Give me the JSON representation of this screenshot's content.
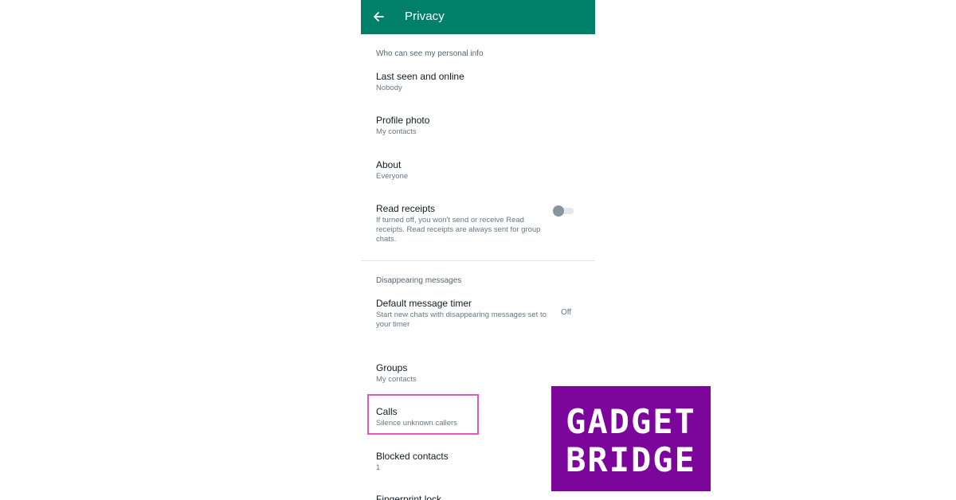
{
  "colors": {
    "appbar": "#008069",
    "highlight_box": "#e754c5",
    "logo_background": "#7c069c"
  },
  "appbar": {
    "back_icon": "arrow-left-icon",
    "title": "Privacy"
  },
  "personal_info": {
    "header": "Who can see my personal info",
    "items": [
      {
        "title": "Last seen and online",
        "subtitle": "Nobody"
      },
      {
        "title": "Profile photo",
        "subtitle": "My contacts"
      },
      {
        "title": "About",
        "subtitle": "Everyone"
      }
    ],
    "read_receipts": {
      "title": "Read receipts",
      "description": "If turned off, you won't send or receive Read receipts. Read receipts are always sent for group chats.",
      "enabled": false
    }
  },
  "disappearing": {
    "header": "Disappearing messages",
    "timer": {
      "title": "Default message timer",
      "subtitle": "Start new chats with disappearing messages set to your timer",
      "value": "Off"
    }
  },
  "more_items": [
    {
      "title": "Groups",
      "subtitle": "My contacts"
    },
    {
      "title": "Calls",
      "subtitle": "Silence unknown callers"
    },
    {
      "title": "Blocked contacts",
      "subtitle": "1"
    },
    {
      "title": "Fingerprint lock"
    }
  ],
  "logo": {
    "line1": "GADGET",
    "line2": "BRIDGE"
  }
}
